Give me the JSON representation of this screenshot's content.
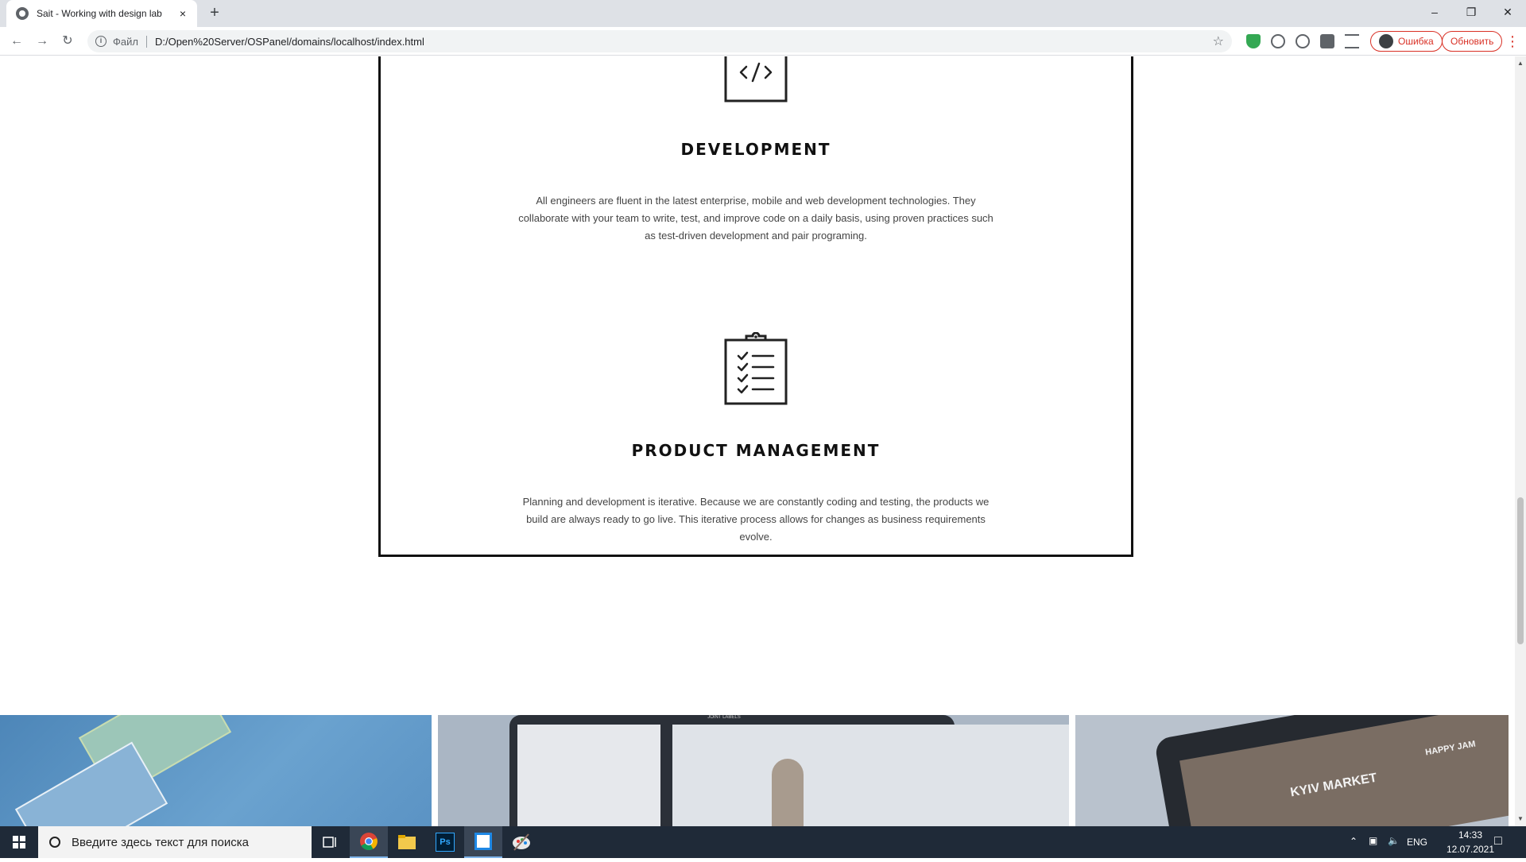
{
  "browser": {
    "tab_title": "Sait - Working with design lab",
    "tab_close": "×",
    "new_tab": "+",
    "scheme_label": "Файл",
    "url": "D:/Open%20Server/OSPanel/domains/localhost/index.html",
    "profile_error_label": "Ошибка",
    "update_label": "Обновить",
    "menu_glyph": "⋮"
  },
  "services": [
    {
      "icon": "code-icon",
      "title": "DEVELOPMENT",
      "description": "All engineers are fluent in the latest enterprise, mobile and web development technologies. They collaborate with your team to write, test, and improve code on a daily basis, using proven practices such as test-driven development and pair programing."
    },
    {
      "icon": "clipboard-checklist-icon",
      "title": "PRODUCT MANAGEMENT",
      "description": "Planning and development is iterative. Because we are constantly coding and testing, the products we build are always ready to go live. This iterative process allows for changes as business requirements evolve."
    }
  ],
  "portfolio": {
    "kyiv_market_label": "KYIV MARKET",
    "happy_jam_label": "HAPPY JAM",
    "joint_labels_label": "JOINT LABELS"
  },
  "taskbar": {
    "search_placeholder": "Введите здесь текст для поиска",
    "language": "ENG",
    "time": "14:33",
    "date": "12.07.2021",
    "ps_label": "Ps"
  },
  "colors": {
    "accent_error": "#d93025",
    "taskbar_bg": "#1f2a38",
    "portfolio_blue": "#5b93c4"
  }
}
